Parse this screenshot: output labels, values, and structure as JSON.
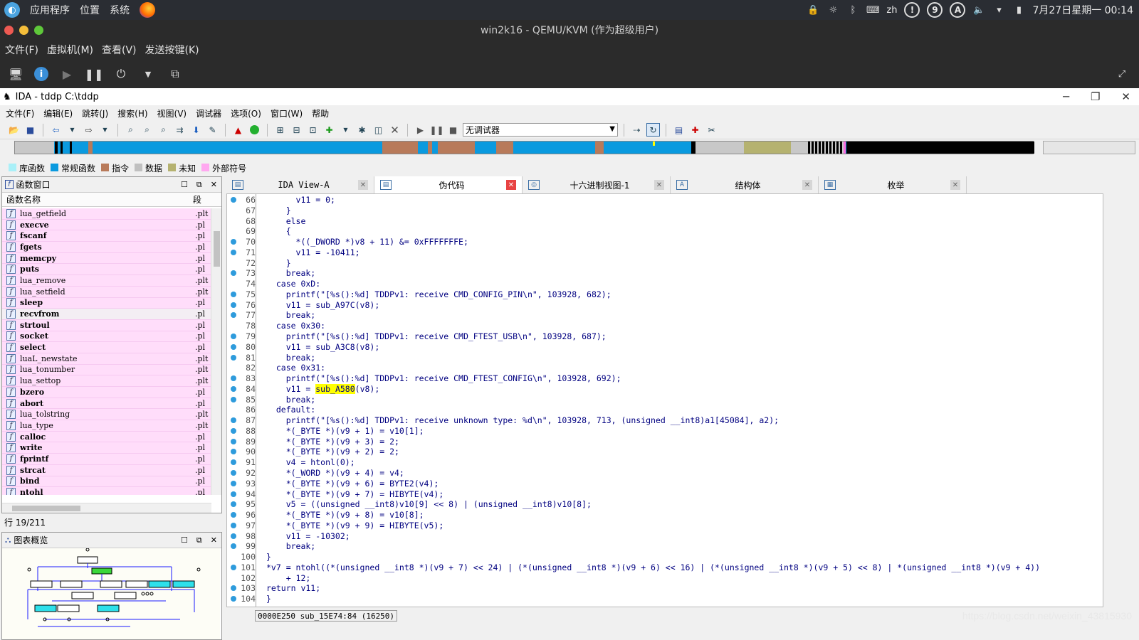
{
  "system_panel": {
    "apps": "应用程序",
    "places": "位置",
    "system": "系统",
    "lang": "zh",
    "tray_9": "9",
    "tray_a": "A",
    "datetime": "7月27日星期一 00:14"
  },
  "qemu": {
    "title": "win2k16 - QEMU/KVM (作为超级用户)",
    "menu": [
      "文件(F)",
      "虚拟机(M)",
      "查看(V)",
      "发送按键(K)"
    ]
  },
  "ida": {
    "title": "IDA - tddp C:\\tddp",
    "menu": [
      "文件(F)",
      "编辑(E)",
      "跳转(J)",
      "搜索(H)",
      "视图(V)",
      "调试器",
      "选项(O)",
      "窗口(W)",
      "帮助"
    ],
    "debugger_select": "无调试器",
    "legend": [
      {
        "label": "库函数",
        "color": "#aaf0f8"
      },
      {
        "label": "常规函数",
        "color": "#0a9adf"
      },
      {
        "label": "指令",
        "color": "#b87a5a"
      },
      {
        "label": "数据",
        "color": "#c0c0c0"
      },
      {
        "label": "未知",
        "color": "#b5b270"
      },
      {
        "label": "外部符号",
        "color": "#ffa8f0"
      }
    ],
    "functions_pane": {
      "title": "函数窗口",
      "col_name": "函数名称",
      "col_seg": "段",
      "row_info": "行 19/211",
      "functions": [
        {
          "name": "lua_getfield",
          "seg": ".plt"
        },
        {
          "name": "execve",
          "seg": ".pl"
        },
        {
          "name": "fscanf",
          "seg": ".pl"
        },
        {
          "name": "fgets",
          "seg": ".pl"
        },
        {
          "name": "memcpy",
          "seg": ".pl"
        },
        {
          "name": "puts",
          "seg": ".pl"
        },
        {
          "name": "lua_remove",
          "seg": ".plt"
        },
        {
          "name": "lua_setfield",
          "seg": ".plt"
        },
        {
          "name": "sleep",
          "seg": ".pl"
        },
        {
          "name": "recvfrom",
          "seg": ".pl"
        },
        {
          "name": "strtoul",
          "seg": ".pl"
        },
        {
          "name": "socket",
          "seg": ".pl"
        },
        {
          "name": "select",
          "seg": ".pl"
        },
        {
          "name": "luaL_newstate",
          "seg": ".plt"
        },
        {
          "name": "lua_tonumber",
          "seg": ".plt"
        },
        {
          "name": "lua_settop",
          "seg": ".plt"
        },
        {
          "name": "bzero",
          "seg": ".pl"
        },
        {
          "name": "abort",
          "seg": ".pl"
        },
        {
          "name": "lua_tolstring",
          "seg": ".plt"
        },
        {
          "name": "lua_type",
          "seg": ".plt"
        },
        {
          "name": "calloc",
          "seg": ".pl"
        },
        {
          "name": "write",
          "seg": ".pl"
        },
        {
          "name": "fprintf",
          "seg": ".pl"
        },
        {
          "name": "strcat",
          "seg": ".pl"
        },
        {
          "name": "bind",
          "seg": ".pl"
        },
        {
          "name": "ntohl",
          "seg": ".pl"
        }
      ]
    },
    "graph_pane": {
      "title": "图表概览"
    },
    "tabs": [
      {
        "label": "IDA View-A",
        "icon": "ida-view-icon"
      },
      {
        "label": "伪代码",
        "icon": "pseudocode-icon"
      },
      {
        "label": "十六进制视图-1",
        "icon": "hex-view-icon"
      },
      {
        "label": "结构体",
        "icon": "structures-icon"
      },
      {
        "label": "枚举",
        "icon": "enums-icon"
      }
    ],
    "code_lines": [
      {
        "n": "66",
        "bp": true,
        "t": "      v11 = 0;"
      },
      {
        "n": "67",
        "bp": false,
        "t": "    }"
      },
      {
        "n": "68",
        "bp": false,
        "t": "    else"
      },
      {
        "n": "69",
        "bp": false,
        "t": "    {"
      },
      {
        "n": "70",
        "bp": true,
        "t": "      *((_DWORD *)v8 + 11) &= 0xFFFFFFFE;"
      },
      {
        "n": "71",
        "bp": true,
        "t": "      v11 = -10411;"
      },
      {
        "n": "72",
        "bp": false,
        "t": "    }"
      },
      {
        "n": "73",
        "bp": true,
        "t": "    break;"
      },
      {
        "n": "74",
        "bp": false,
        "t": "  case 0xD:"
      },
      {
        "n": "75",
        "bp": true,
        "t": "    printf(\"[%s():%d] TDDPv1: receive CMD_CONFIG_PIN\\n\", 103928, 682);"
      },
      {
        "n": "76",
        "bp": true,
        "t": "    v11 = sub_A97C(v8);"
      },
      {
        "n": "77",
        "bp": true,
        "t": "    break;"
      },
      {
        "n": "78",
        "bp": false,
        "t": "  case 0x30:"
      },
      {
        "n": "79",
        "bp": true,
        "t": "    printf(\"[%s():%d] TDDPv1: receive CMD_FTEST_USB\\n\", 103928, 687);"
      },
      {
        "n": "80",
        "bp": true,
        "t": "    v11 = sub_A3C8(v8);"
      },
      {
        "n": "81",
        "bp": true,
        "t": "    break;"
      },
      {
        "n": "82",
        "bp": false,
        "t": "  case 0x31:"
      },
      {
        "n": "83",
        "bp": true,
        "t": "    printf(\"[%s():%d] TDDPv1: receive CMD_FTEST_CONFIG\\n\", 103928, 692);"
      },
      {
        "n": "84",
        "bp": true,
        "t": "    v11 = sub_A580(v8);"
      },
      {
        "n": "85",
        "bp": true,
        "t": "    break;"
      },
      {
        "n": "86",
        "bp": false,
        "t": "  default:"
      },
      {
        "n": "87",
        "bp": true,
        "t": "    printf(\"[%s():%d] TDDPv1: receive unknown type: %d\\n\", 103928, 713, (unsigned __int8)a1[45084], a2);"
      },
      {
        "n": "88",
        "bp": true,
        "t": "    *(_BYTE *)(v9 + 1) = v10[1];"
      },
      {
        "n": "89",
        "bp": true,
        "t": "    *(_BYTE *)(v9 + 3) = 2;"
      },
      {
        "n": "90",
        "bp": true,
        "t": "    *(_BYTE *)(v9 + 2) = 2;"
      },
      {
        "n": "91",
        "bp": true,
        "t": "    v4 = htonl(0);"
      },
      {
        "n": "92",
        "bp": true,
        "t": "    *(_WORD *)(v9 + 4) = v4;"
      },
      {
        "n": "93",
        "bp": true,
        "t": "    *(_BYTE *)(v9 + 6) = BYTE2(v4);"
      },
      {
        "n": "94",
        "bp": true,
        "t": "    *(_BYTE *)(v9 + 7) = HIBYTE(v4);"
      },
      {
        "n": "95",
        "bp": true,
        "t": "    v5 = ((unsigned __int8)v10[9] << 8) | (unsigned __int8)v10[8];"
      },
      {
        "n": "96",
        "bp": true,
        "t": "    *(_BYTE *)(v9 + 8) = v10[8];"
      },
      {
        "n": "97",
        "bp": true,
        "t": "    *(_BYTE *)(v9 + 9) = HIBYTE(v5);"
      },
      {
        "n": "98",
        "bp": true,
        "t": "    v11 = -10302;"
      },
      {
        "n": "99",
        "bp": true,
        "t": "    break;"
      },
      {
        "n": "100",
        "bp": false,
        "t": "}"
      },
      {
        "n": "101",
        "bp": true,
        "t": "*v7 = ntohl((*(unsigned __int8 *)(v9 + 7) << 24) | (*(unsigned __int8 *)(v9 + 6) << 16) | (*(unsigned __int8 *)(v9 + 5) << 8) | *(unsigned __int8 *)(v9 + 4))"
      },
      {
        "n": "102",
        "bp": false,
        "t": "    + 12;"
      },
      {
        "n": "103",
        "bp": true,
        "t": "return v11;"
      },
      {
        "n": "104",
        "bp": true,
        "t": "}"
      }
    ],
    "highlight_token": "sub_A580",
    "status_text": "0000E250 sub_15E74:84 (16250)",
    "watermark": "https://blog.csdn.net/weixin_43815930"
  }
}
